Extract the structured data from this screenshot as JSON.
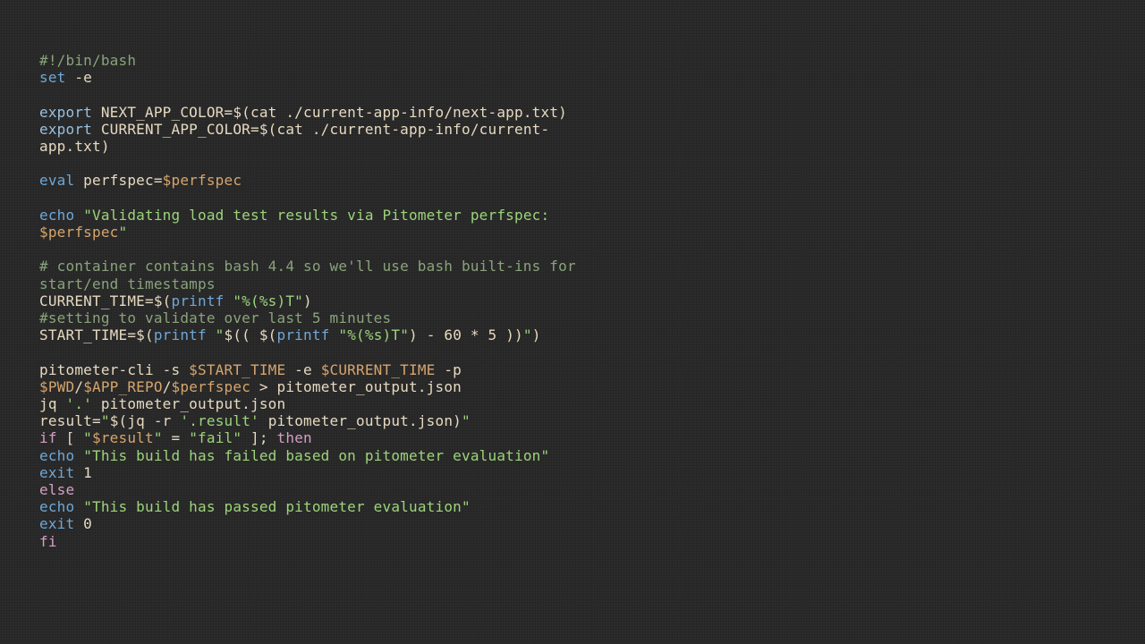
{
  "code": {
    "l01_shebang": "#!/bin/bash",
    "l02_set": "set",
    "l02_opt": " -e",
    "l04_export": "export",
    "l04_var": " NEXT_APP_COLOR",
    "l04_eq": "=$(",
    "l04_cmd": "cat ./current-app-info/next-app.txt",
    "l04_close": ")",
    "l05_export": "export",
    "l05_var": " CURRENT_APP_COLOR",
    "l05_eq": "=$(",
    "l05_cmd": "cat ./current-app-info/current-app.txt",
    "l05_close": ")",
    "l07_eval": "eval",
    "l07_rest": " perfspec=",
    "l07_var": "$perfspec",
    "l09_echo": "echo",
    "l09_sp": " ",
    "l09_str1": "\"Validating load test results via Pitometer perfspec: ",
    "l09_var": "$perfspec",
    "l09_str2": "\"",
    "l11_comment": "# container contains bash 4.4 so we'll use bash built-ins for start/end timestamps",
    "l12_a": "CURRENT_TIME=$(",
    "l12_printf": "printf",
    "l12_sp": " ",
    "l12_str": "\"%(%s)T\"",
    "l12_b": ")",
    "l13_comment": "#setting to validate over last 5 minutes",
    "l14_a": "START_TIME=$(",
    "l14_printf1": "printf",
    "l14_sp1": " ",
    "l14_q1": "\"",
    "l14_b": "$(( $(",
    "l14_printf2": "printf",
    "l14_sp2": " ",
    "l14_str": "\"%(%s)T\"",
    "l14_c": ") - 60 * 5 ))",
    "l14_q2": "\"",
    "l14_d": ")",
    "l16_a": "pitometer-cli -s ",
    "l16_v1": "$START_TIME",
    "l16_b": " -e ",
    "l16_v2": "$CURRENT_TIME",
    "l16_c": " -p ",
    "l16_v3": "$PWD",
    "l16_slash1": "/",
    "l16_v4": "$APP_REPO",
    "l16_slash2": "/",
    "l16_v5": "$perfspec",
    "l16_d": " > pitometer_output.json",
    "l17_a": "jq ",
    "l17_str": "'.'",
    "l17_b": " pitometer_output.json",
    "l18_a": "result=",
    "l18_q1": "\"",
    "l18_b": "$(jq -r ",
    "l18_str": "'.result'",
    "l18_c": " pitometer_output.json)",
    "l18_q2": "\"",
    "l19_if": "if",
    "l19_a": " [ ",
    "l19_q1": "\"",
    "l19_var": "$result",
    "l19_q2": "\"",
    "l19_b": " = ",
    "l19_str": "\"fail\"",
    "l19_c": " ]; ",
    "l19_then": "then",
    "l20_echo": "echo",
    "l20_sp": " ",
    "l20_str": "\"This build has failed based on pitometer evaluation\"",
    "l21_exit": "exit",
    "l21_n": " 1",
    "l22_else": "else",
    "l23_echo": "echo",
    "l23_sp": " ",
    "l23_str": "\"This build has passed pitometer evaluation\"",
    "l24_exit": "exit",
    "l24_n": " 0",
    "l25_fi": "fi"
  }
}
